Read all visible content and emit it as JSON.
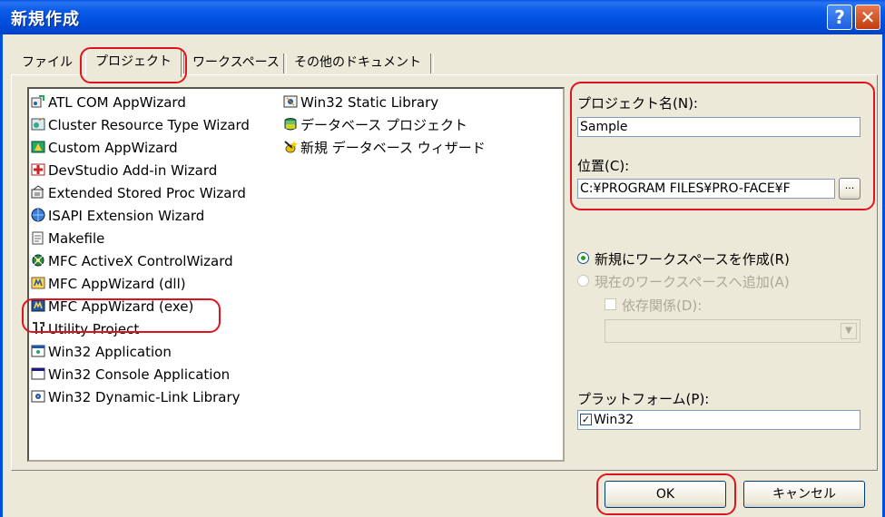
{
  "window": {
    "title": "新規作成",
    "help_btn": "?",
    "close_btn": "✕"
  },
  "tabs": [
    "ファイル",
    "プロジェクト",
    "ワークスペース",
    "その他のドキュメント"
  ],
  "project_types_col1": [
    {
      "label": "ATL COM AppWizard",
      "icon": "atl-wizard-icon"
    },
    {
      "label": "Cluster Resource Type Wizard",
      "icon": "cluster-wizard-icon"
    },
    {
      "label": "Custom AppWizard",
      "icon": "custom-wizard-icon"
    },
    {
      "label": "DevStudio Add-in Wizard",
      "icon": "addin-wizard-icon"
    },
    {
      "label": "Extended Stored Proc Wizard",
      "icon": "stored-proc-icon"
    },
    {
      "label": "ISAPI Extension Wizard",
      "icon": "isapi-icon"
    },
    {
      "label": "Makefile",
      "icon": "makefile-icon"
    },
    {
      "label": "MFC ActiveX ControlWizard",
      "icon": "activex-icon"
    },
    {
      "label": "MFC AppWizard (dll)",
      "icon": "mfc-dll-icon"
    },
    {
      "label": "MFC AppWizard (exe)",
      "icon": "mfc-exe-icon"
    },
    {
      "label": "Utility Project",
      "icon": "utility-icon"
    },
    {
      "label": "Win32 Application",
      "icon": "win32-app-icon"
    },
    {
      "label": "Win32 Console Application",
      "icon": "console-icon"
    },
    {
      "label": "Win32 Dynamic-Link Library",
      "icon": "dll-icon"
    }
  ],
  "project_types_col2": [
    {
      "label": "Win32 Static Library",
      "icon": "static-lib-icon"
    },
    {
      "label": "データベース プロジェクト",
      "icon": "database-project-icon"
    },
    {
      "label": "新規 データベース ウィザード",
      "icon": "new-database-wizard-icon"
    }
  ],
  "form": {
    "project_name_label": "プロジェクト名(N):",
    "project_name_value": "Sample",
    "location_label": "位置(C):",
    "location_value": "C:¥PROGRAM FILES¥PRO-FACE¥F",
    "browse_btn": "...",
    "radio_new_ws": "新規にワークスペースを作成(R)",
    "radio_add_ws": "現在のワークスペースへ追加(A)",
    "dependency_label": "依存関係(D):",
    "platform_label": "プラットフォーム(P):",
    "platform_item": "Win32"
  },
  "buttons": {
    "ok": "OK",
    "cancel": "キャンセル"
  },
  "colors": {
    "title_bar": "#0050df",
    "highlight_red": "#e0141e",
    "dialog_bg": "#ece9d8"
  }
}
